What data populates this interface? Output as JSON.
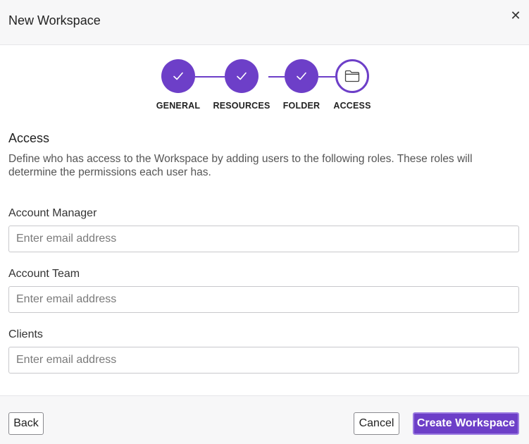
{
  "dialog": {
    "title": "New Workspace",
    "close_icon": "close-icon"
  },
  "stepper": {
    "steps": [
      {
        "label": "GENERAL",
        "status": "complete",
        "icon": "checkmark-icon"
      },
      {
        "label": "RESOURCES",
        "status": "complete",
        "icon": "checkmark-icon"
      },
      {
        "label": "FOLDER",
        "status": "complete",
        "icon": "checkmark-icon"
      },
      {
        "label": "ACCESS",
        "status": "active",
        "icon": "folder-icon"
      }
    ]
  },
  "section": {
    "title": "Access",
    "description": "Define who has access to the Workspace by adding users to the following roles. These roles will determine the permissions each user has."
  },
  "fields": [
    {
      "label": "Account Manager",
      "placeholder": "Enter email address",
      "value": ""
    },
    {
      "label": "Account Team",
      "placeholder": "Enter email address",
      "value": ""
    },
    {
      "label": "Clients",
      "placeholder": "Enter email address",
      "value": ""
    }
  ],
  "footer": {
    "back_label": "Back",
    "cancel_label": "Cancel",
    "create_label": "Create Workspace"
  },
  "colors": {
    "accent": "#6d3fc8",
    "accent_border": "#9b7be0",
    "header_bg": "#f7f7f8",
    "input_border": "#c8c8cc"
  }
}
